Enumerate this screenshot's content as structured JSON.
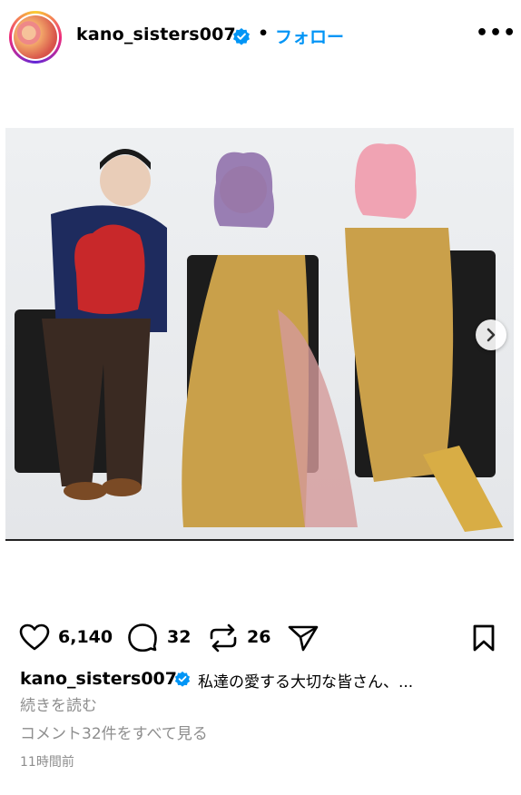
{
  "header": {
    "username": "kano_sisters007",
    "separator": "•",
    "follow_label": "フォロー",
    "more_label": "•••"
  },
  "post": {
    "likes": "6,140",
    "comments": "32",
    "reposts": "26"
  },
  "caption": {
    "username": "kano_sisters007",
    "text": "私達の愛する大切な皆さん、...",
    "more_label": "続きを読む",
    "view_comments_label": "コメント32件をすべて見る",
    "timestamp": "11時間前"
  },
  "colors": {
    "accent": "#0095f6",
    "muted": "#8e8e8e",
    "verified": "#0095f6"
  }
}
